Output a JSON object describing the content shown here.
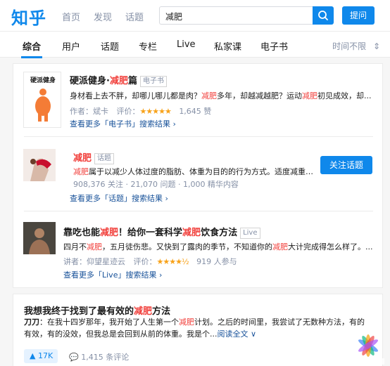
{
  "header": {
    "logo": "知乎",
    "nav": [
      "首页",
      "发现",
      "话题"
    ],
    "search_value": "减肥",
    "ask_label": "提问"
  },
  "tabs": {
    "items": [
      "综合",
      "用户",
      "话题",
      "专栏",
      "Live",
      "私家课",
      "电子书"
    ],
    "time_filter": "时间不限",
    "time_filter_arrow": "⇕"
  },
  "ebook": {
    "cover_title": "硬派健身",
    "title_pre": "硬派健身·",
    "title_hl": "减肥",
    "title_post": "篇",
    "tag": "电子书",
    "desc_pre": "身材看上去不胖，却哪儿哪儿都是肉？",
    "desc_hl1": "减肥",
    "desc_mid": "多年，却越减越肥？运动",
    "desc_hl2": "减肥",
    "desc_post": "初见成效，却...",
    "author_label": "作者：斌卡",
    "rating_label": "评价：",
    "stars": "★★★★★",
    "likes": "1,645 赞",
    "more": "查看更多「电子书」搜索结果 ›"
  },
  "topic": {
    "title": "减肥",
    "tag": "话题",
    "desc_hl": "减肥",
    "desc_post": "属于以减少人体过度的脂肪、体重为目的的行为方式。适度减重可...",
    "stats": "908,376 关注 · 21,070 问题 · 1,000 精华内容",
    "follow_label": "关注话题",
    "more": "查看更多「话题」搜索结果 ›"
  },
  "live": {
    "title_pre": "靠吃也能",
    "title_hl1": "减肥",
    "title_mid": "！给你一套科学",
    "title_hl2": "减肥",
    "title_post": "饮食方法",
    "tag": "Live",
    "desc_pre": "四月不",
    "desc_hl1": "减肥",
    "desc_mid": "，五月徒伤悲。又快到了露肉的季节，不知道你的",
    "desc_hl2": "减肥",
    "desc_post": "大计完成得怎么样了。...",
    "speaker_label": "讲者：仰望星迹云",
    "rating_label": "评价：",
    "stars": "★★★★½",
    "participants": "919 人参与",
    "more": "查看更多「Live」搜索结果 ›"
  },
  "answer": {
    "title_pre": "我想我终于找到了最有效的",
    "title_hl": "减肥",
    "title_post": "方法",
    "author": "刀刀",
    "body_pre": "：在我十四岁那年，我开始了人生第一个",
    "body_hl": "减肥",
    "body_post": "计划。之后的时间里，我尝试了无数种方法，有的有效，有的没效，但我总是会回到从前的体重。我是个...",
    "read_more": "阅读全文 ∨",
    "votes": "▲ 17K",
    "comments": "1,415 条评论"
  },
  "colors": {
    "brand": "#0f88eb",
    "highlight": "#f1403c",
    "star": "#f8a219"
  }
}
